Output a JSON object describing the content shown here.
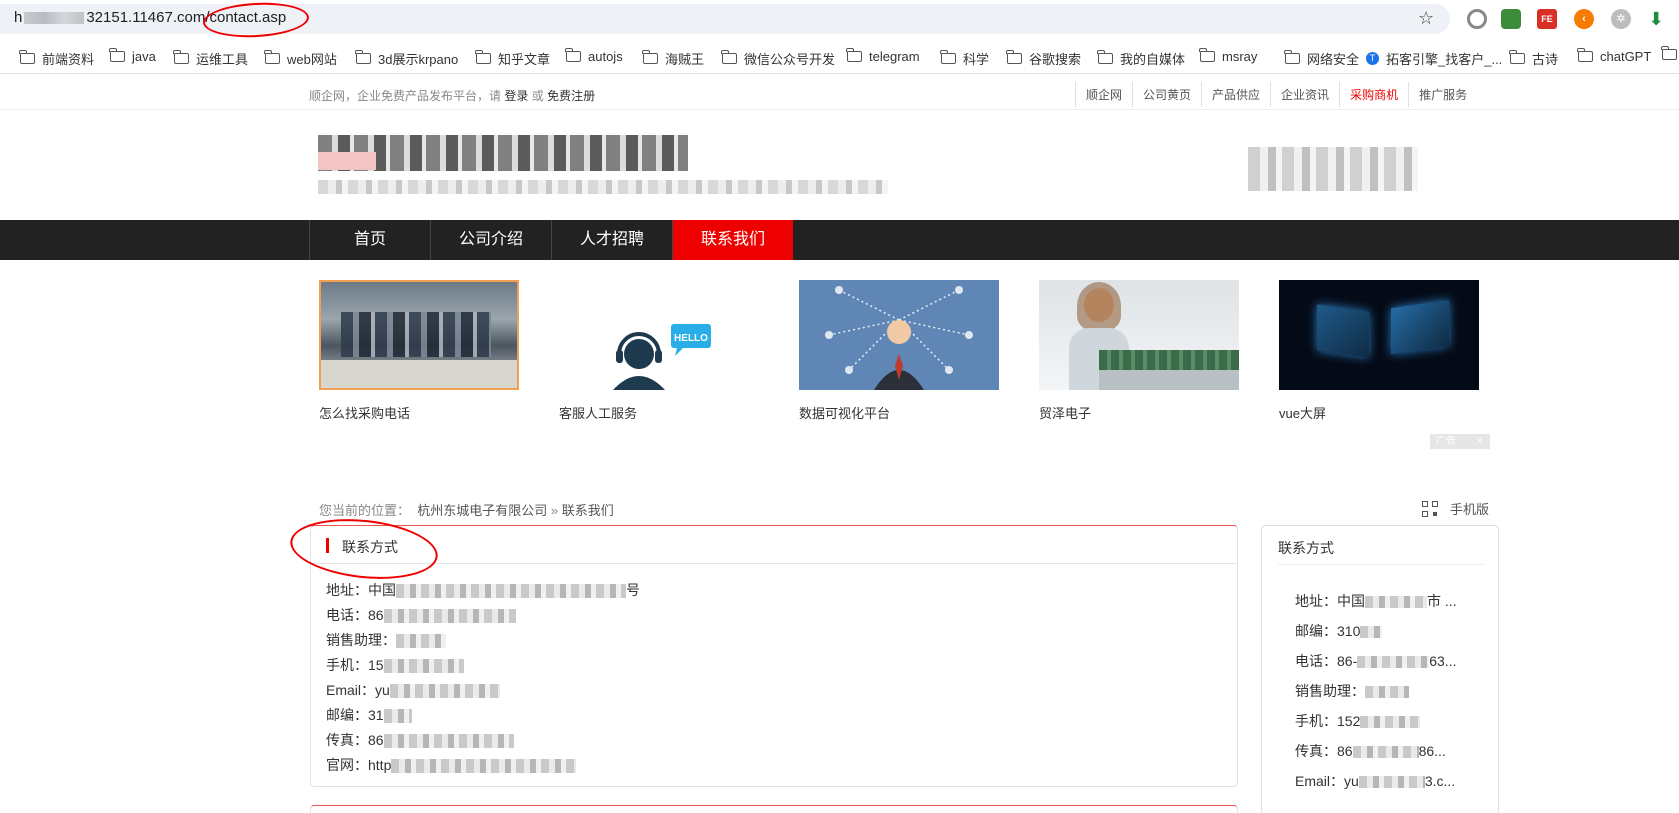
{
  "browser": {
    "url_prefix": "h",
    "url_mid": "32151.11467.com",
    "url_path": "/contact.asp",
    "bookmarks": [
      "前端资料",
      "java",
      "运维工具",
      "web网站",
      "3d展示krpano",
      "知乎文章",
      "autojs",
      "海贼王",
      "微信公众号开发",
      "telegram",
      "科学",
      "谷歌搜索",
      "我的自媒体",
      "msray",
      "网络安全",
      "拓客引擎_找客户_...",
      "古诗",
      "chatGPT"
    ],
    "extension_colors": [
      "#888888",
      "#3c8c3c",
      "#d93025",
      "#f57c00",
      "#9e9e9e",
      "#1e8e3e"
    ]
  },
  "site": {
    "welcome_prefix": "顺企网，企业免费产品发布平台，请",
    "login": "登录",
    "or": "或",
    "register": "免费注册",
    "top_links": [
      "顺企网",
      "公司黄页",
      "产品供应",
      "企业资讯",
      "采购商机",
      "推广服务"
    ],
    "top_links_highlight": "采购商机",
    "nav": [
      "首页",
      "公司介绍",
      "人才招聘",
      "联系我们"
    ],
    "nav_active": "联系我们",
    "ads": [
      {
        "caption": "怎么找采购电话",
        "icon": "lab-photo"
      },
      {
        "caption": "客服人工服务",
        "icon": "headset-hello-icon"
      },
      {
        "caption": "数据可视化平台",
        "icon": "businessman-network"
      },
      {
        "caption": "贸泽电子",
        "icon": "woman-with-circuit-board"
      },
      {
        "caption": "vue大屏",
        "icon": "dark-dashboard-screens"
      }
    ],
    "ad_badge": "广告",
    "breadcrumb_label": "您当前的位置：",
    "breadcrumb_company": "杭州东城电子有限公司",
    "breadcrumb_sep": "»",
    "breadcrumb_current": "联系我们",
    "mobile_label": "手机版",
    "accent": "#ee0000"
  },
  "contact": {
    "title": "联系方式",
    "rows": [
      {
        "label": "地址：",
        "value": "中国"
      },
      {
        "label": "电话：",
        "value": "86"
      },
      {
        "label": "销售助理：",
        "value": ""
      },
      {
        "label": "手机：",
        "value": "15"
      },
      {
        "label": "Email：",
        "value": "yu"
      },
      {
        "label": "邮编：",
        "value": "31"
      },
      {
        "label": "传真：",
        "value": "86"
      },
      {
        "label": "官网：",
        "value": "http"
      }
    ],
    "address_tail": "号"
  },
  "sidebar": {
    "title": "联系方式",
    "rows": [
      {
        "label": "地址：",
        "value": "中国",
        "tail": "市 ..."
      },
      {
        "label": "邮编：",
        "value": "310",
        "tail": ""
      },
      {
        "label": "电话：",
        "value": "86-",
        "tail": "63..."
      },
      {
        "label": "销售助理：",
        "value": "",
        "tail": ""
      },
      {
        "label": "手机：",
        "value": "152",
        "tail": ""
      },
      {
        "label": "传真：",
        "value": "86",
        "tail": "86..."
      },
      {
        "label": "Email：",
        "value": "yu",
        "tail": "3.c..."
      }
    ]
  }
}
